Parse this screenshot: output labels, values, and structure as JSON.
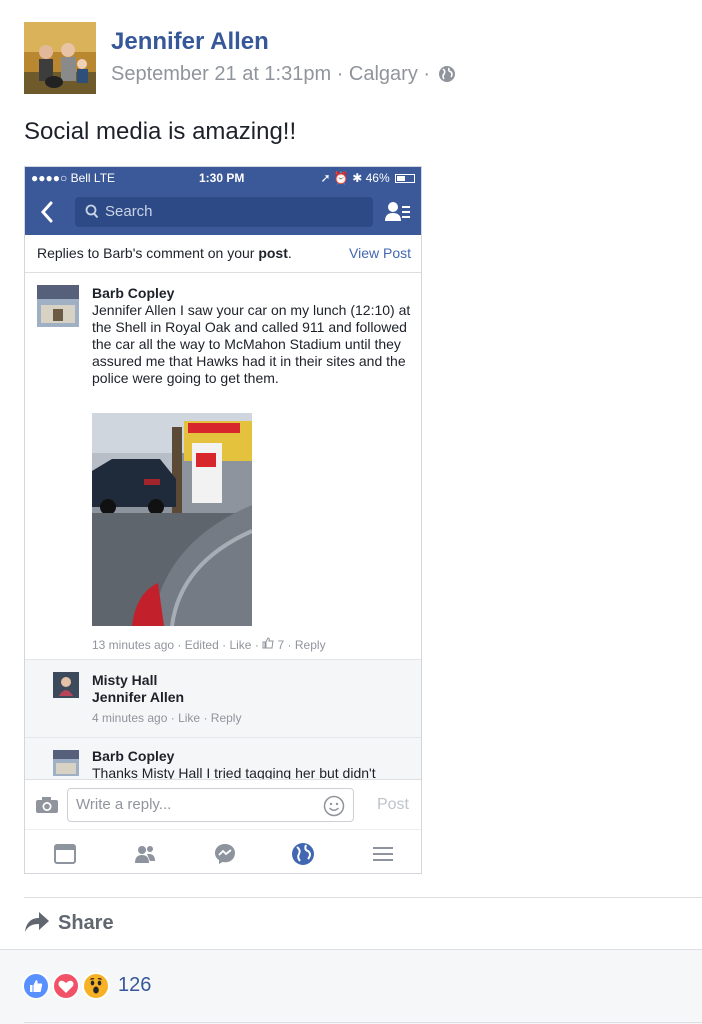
{
  "post": {
    "author": "Jennifer Allen",
    "date": "September 21 at 1:31pm",
    "location": "Calgary",
    "text": "Social media is amazing!!"
  },
  "phone": {
    "status": {
      "carrier": "●●●●○ Bell  LTE",
      "time": "1:30 PM",
      "battery": "46%"
    },
    "search_placeholder": "Search",
    "replies_prefix": "Replies to Barb's comment on your ",
    "replies_bold": "post",
    "replies_suffix": ".",
    "view_post": "View Post",
    "comments": [
      {
        "name": "Barb Copley",
        "text": "Jennifer Allen I saw your car on my lunch (12:10) at the Shell in Royal Oak and called 911 and followed the car all the way to McMahon Stadium until they assured me that Hawks had it in their sites and the police were going to get them.",
        "time": "13 minutes ago",
        "edited": "Edited",
        "like": "Like",
        "likes": "7",
        "reply": "Reply"
      },
      {
        "name": "Misty Hall",
        "text": "Jennifer Allen",
        "time": "4 minutes ago",
        "like": "Like",
        "reply": "Reply"
      },
      {
        "name": "Barb Copley",
        "text": "Thanks Misty Hall I tried tagging her but didn't"
      }
    ],
    "reply_placeholder": "Write a reply...",
    "post_label": "Post"
  },
  "footer": {
    "share_label": "Share",
    "reaction_count": "126",
    "colors": {
      "like": "#5890ff",
      "love": "#f25268",
      "wow": "#f7b125",
      "link": "#365899"
    }
  }
}
